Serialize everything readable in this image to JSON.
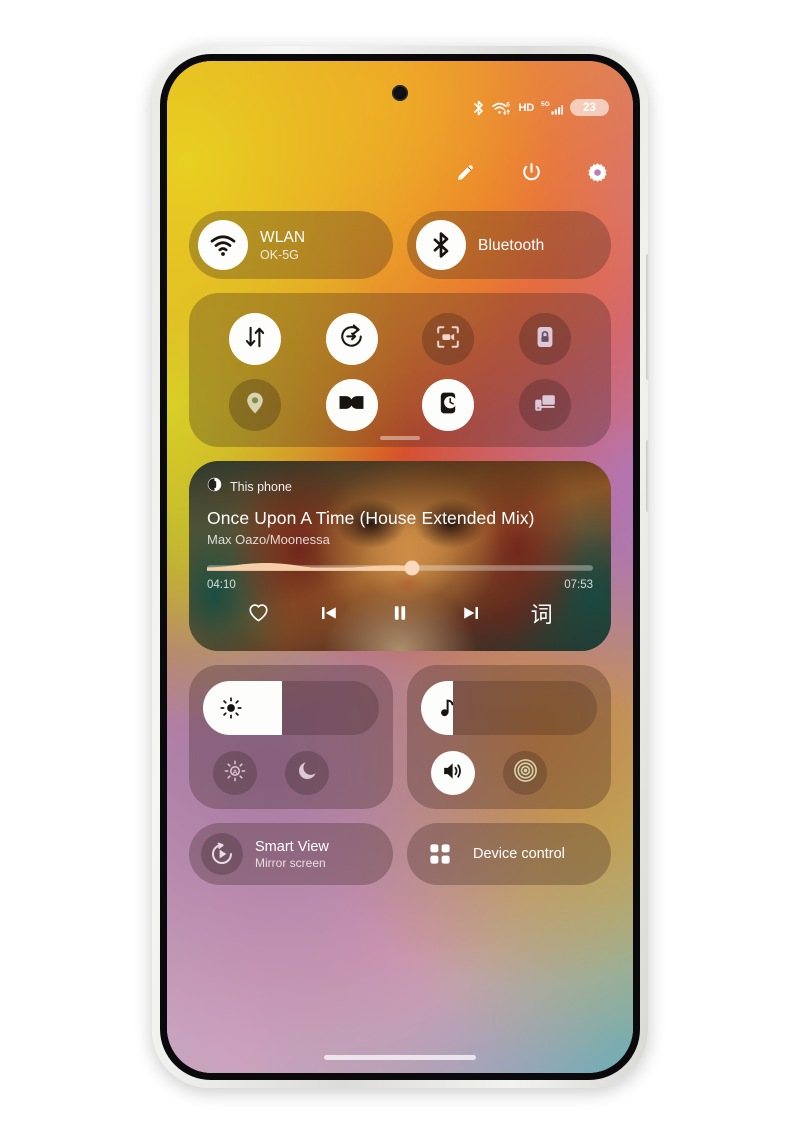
{
  "status_bar": {
    "bluetooth_icon": "bluetooth-icon",
    "wifi_icon": "wifi-6-icon",
    "hd_label": "HD",
    "network_label": "5G",
    "signal_icon": "signal-bars-icon",
    "battery_percent": "23"
  },
  "top_actions": [
    {
      "name": "edit-button",
      "icon": "pencil-icon"
    },
    {
      "name": "power-button",
      "icon": "power-icon"
    },
    {
      "name": "settings-button",
      "icon": "gear-icon"
    }
  ],
  "connectivity": [
    {
      "name": "wlan-toggle",
      "icon": "wifi-icon",
      "title": "WLAN",
      "subtitle": "OK-5G",
      "active": true
    },
    {
      "name": "bluetooth-toggle",
      "icon": "bluetooth-icon",
      "title": "Bluetooth",
      "subtitle": "",
      "active": true
    }
  ],
  "toggles": {
    "row1": [
      {
        "name": "mobile-data-toggle",
        "icon": "data-transfer-icon",
        "active": true
      },
      {
        "name": "auto-rotate-toggle",
        "icon": "auto-rotate-icon",
        "active": true
      },
      {
        "name": "screen-recorder-toggle",
        "icon": "screen-recorder-icon",
        "active": false
      },
      {
        "name": "screen-lock-toggle",
        "icon": "lock-icon",
        "active": false
      }
    ],
    "row2": [
      {
        "name": "location-toggle",
        "icon": "location-pin-icon",
        "active": false
      },
      {
        "name": "dolby-atmos-toggle",
        "icon": "dolby-atmos-icon",
        "active": true
      },
      {
        "name": "bedtime-mode-toggle",
        "icon": "bedtime-clock-icon",
        "active": true
      },
      {
        "name": "link-to-windows-toggle",
        "icon": "phone-to-pc-icon",
        "active": false
      }
    ]
  },
  "media": {
    "output_icon": "this-phone-icon",
    "output_label": "This phone",
    "track_title": "Once Upon A Time (House Extended Mix)",
    "artist": "Max Oazo/Moonessa",
    "elapsed": "04:10",
    "duration": "07:53",
    "progress_percent": 53,
    "controls": [
      {
        "name": "favorite-button",
        "icon": "heart-icon"
      },
      {
        "name": "previous-track-button",
        "icon": "skip-previous-icon"
      },
      {
        "name": "pause-button",
        "icon": "pause-icon"
      },
      {
        "name": "next-track-button",
        "icon": "skip-next-icon"
      },
      {
        "name": "lyrics-button",
        "icon": "lyrics-icon",
        "glyph": "词"
      }
    ]
  },
  "brightness": {
    "slider_name": "brightness-slider",
    "icon": "brightness-icon",
    "value_percent": 45,
    "sub_buttons": [
      {
        "name": "auto-brightness-button",
        "icon": "auto-brightness-icon",
        "active": false
      },
      {
        "name": "dark-mode-button",
        "icon": "moon-icon",
        "active": false
      }
    ]
  },
  "volume": {
    "slider_name": "volume-slider",
    "icon": "music-note-icon",
    "value_percent": 18,
    "sub_buttons": [
      {
        "name": "sound-mode-button",
        "icon": "speaker-icon",
        "active": true
      },
      {
        "name": "vibration-pattern-button",
        "icon": "vibration-rings-icon",
        "active": false
      }
    ]
  },
  "shortcuts": [
    {
      "name": "smart-view-button",
      "icon": "smart-view-icon",
      "title": "Smart View",
      "subtitle": "Mirror screen"
    },
    {
      "name": "device-control-button",
      "icon": "device-control-grid-icon",
      "title": "Device control",
      "subtitle": ""
    }
  ],
  "colors": {
    "accent_white": "#fdfdfb",
    "panel_overlay": "rgba(58,38,34,0.30)",
    "progress_fill": "#f6cfa8",
    "knob": "#fbd9c0"
  }
}
